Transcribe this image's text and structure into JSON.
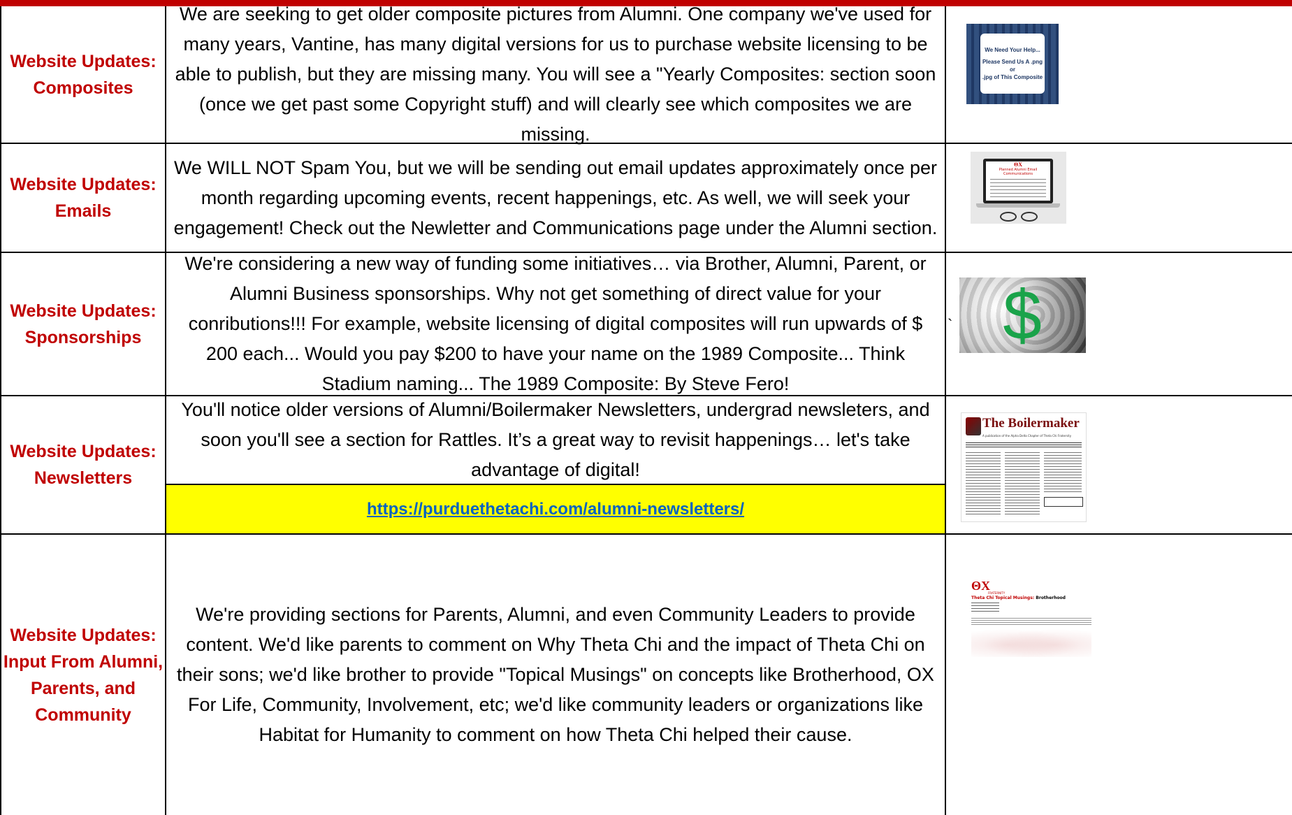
{
  "rows": [
    {
      "label_line1": "Website Updates:",
      "label_line2": "Composites",
      "description": "We are seeking to get older composite pictures from Alumni.  One company we've used for many years, Vantine, has many digital versions for us to purchase website licensing to be able to publish, but they are missing many.  You will see a \"Yearly Composites: section soon (once we get past some Copyright stuff) and will clearly see which composites we are missing.",
      "thumb": {
        "line1": "We Need Your Help...",
        "line2": "Please Send Us A .png or",
        "line3": ".jpg of This Composite"
      }
    },
    {
      "label_line1": "Website Updates:",
      "label_line2": "Emails",
      "description": "We WILL NOT Spam You, but we will be sending out email updates approximately once per month regarding upcoming events, recent happenings, etc.  As well, we will seek your engagement!  Check out the Newletter and Communications page under the Alumni section.",
      "thumb": {
        "logo": "ΘX",
        "title": "Planned Alumni Email Communications"
      }
    },
    {
      "label_line1": "Website Updates:",
      "label_line2": "Sponsorships",
      "description": "We're considering a new way of funding some initiatives… via Brother, Alumni, Parent, or Alumni Business sponsorships.  Why not get something of direct value for your conributions!!!  For example, website licensing of digital composites will run upwards of $ 200 each... Would you pay $200 to have your name on the 1989 Composite... Think Stadium naming... The 1989 Composite: By Steve Fero!",
      "thumb": {
        "symbol": "$"
      },
      "mark": "`"
    },
    {
      "label_line1": "Website Updates:",
      "label_line2": "Newsletters",
      "description": "You'll  notice older versions of Alumni/Boilermaker Newsletters, undergrad newsleters, and soon you'll see a section for Rattles.  It’s a great way to revisit happenings… let's take advantage of digital!",
      "link": "https://purduethetachi.com/alumni-newsletters/",
      "thumb": {
        "title": "The Boilermaker",
        "subtitle": "A publication of the Alpha Delta Chapter of Theta Chi Fraternity"
      }
    },
    {
      "label_line1": "Website Updates:",
      "label_line2": "Input From Alumni,",
      "label_line3": "Parents, and",
      "label_line4": "Community",
      "description": "We're providing sections for Parents, Alumni, and even Community Leaders to provide content.  We'd like parents to comment on Why Theta Chi and the impact of Theta Chi on their sons; we'd like brother to provide \"Topical Musings\" on concepts like Brotherhood, OX For Life, Community, Involvement, etc; we'd like community leaders or organizations like Habitat for Humanity to comment on how Theta Chi helped their cause.",
      "thumb": {
        "logo": "ΘX",
        "logo_sub": "FRATERNITY",
        "title_a": "Theta Chi Topical Musings: ",
        "title_b": "Brotherhood"
      }
    }
  ],
  "colors": {
    "header": "#c00000",
    "label": "#c00000",
    "link_bg": "#ffff00",
    "link": "#0563c1"
  }
}
